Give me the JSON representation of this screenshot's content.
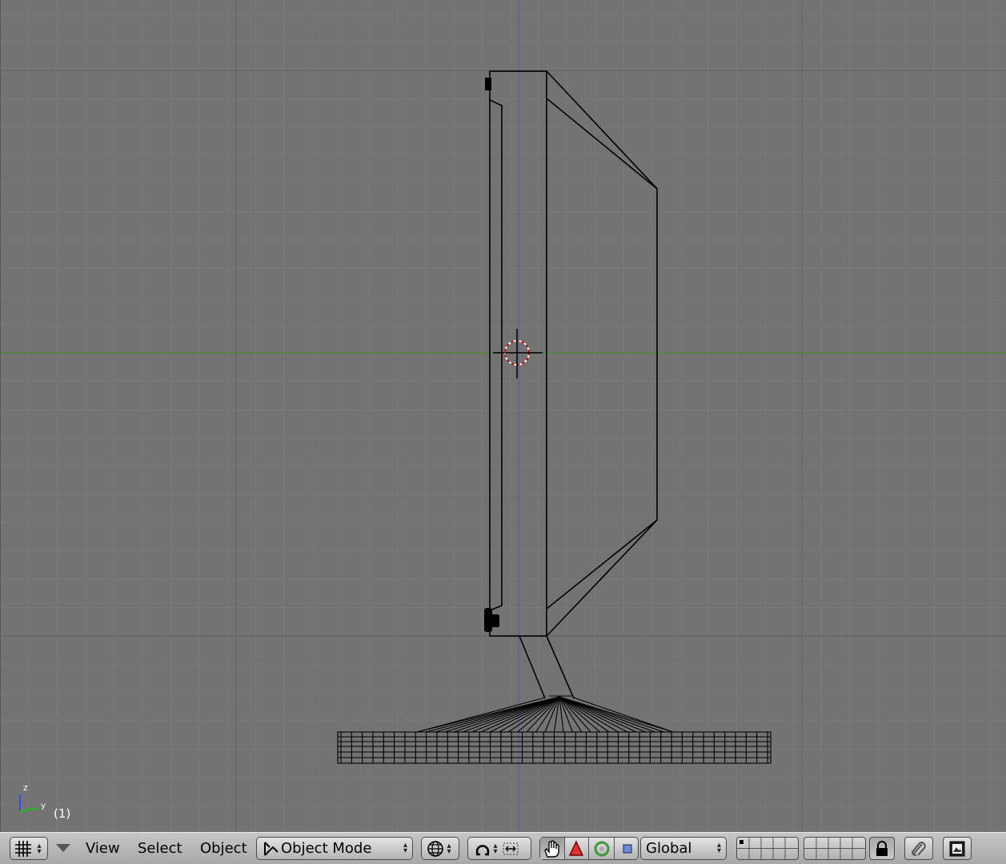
{
  "viewport": {
    "frame_label": "(1)",
    "axis_labels": {
      "z": "z",
      "y": "y"
    },
    "colors": {
      "background": "#737373",
      "grid": "#7e7e7e",
      "grid_major": "#666666",
      "axis_x": "#4a8a2a",
      "axis_z": "#6a5aa0",
      "wire": "#000000"
    }
  },
  "header": {
    "menus": {
      "view": "View",
      "select": "Select",
      "object": "Object"
    },
    "mode": "Object Mode",
    "orientation": "Global",
    "icons": {
      "editor": "grid-icon",
      "draw_type": "wireframe-sphere-icon",
      "pivot": "pivot-icon",
      "manipulator": "hand-icon",
      "translate": "triangle-icon",
      "rotate": "ring-icon",
      "scale": "square-icon",
      "lock": "lock-icon",
      "link": "link-icon",
      "render": "render-icon"
    }
  }
}
